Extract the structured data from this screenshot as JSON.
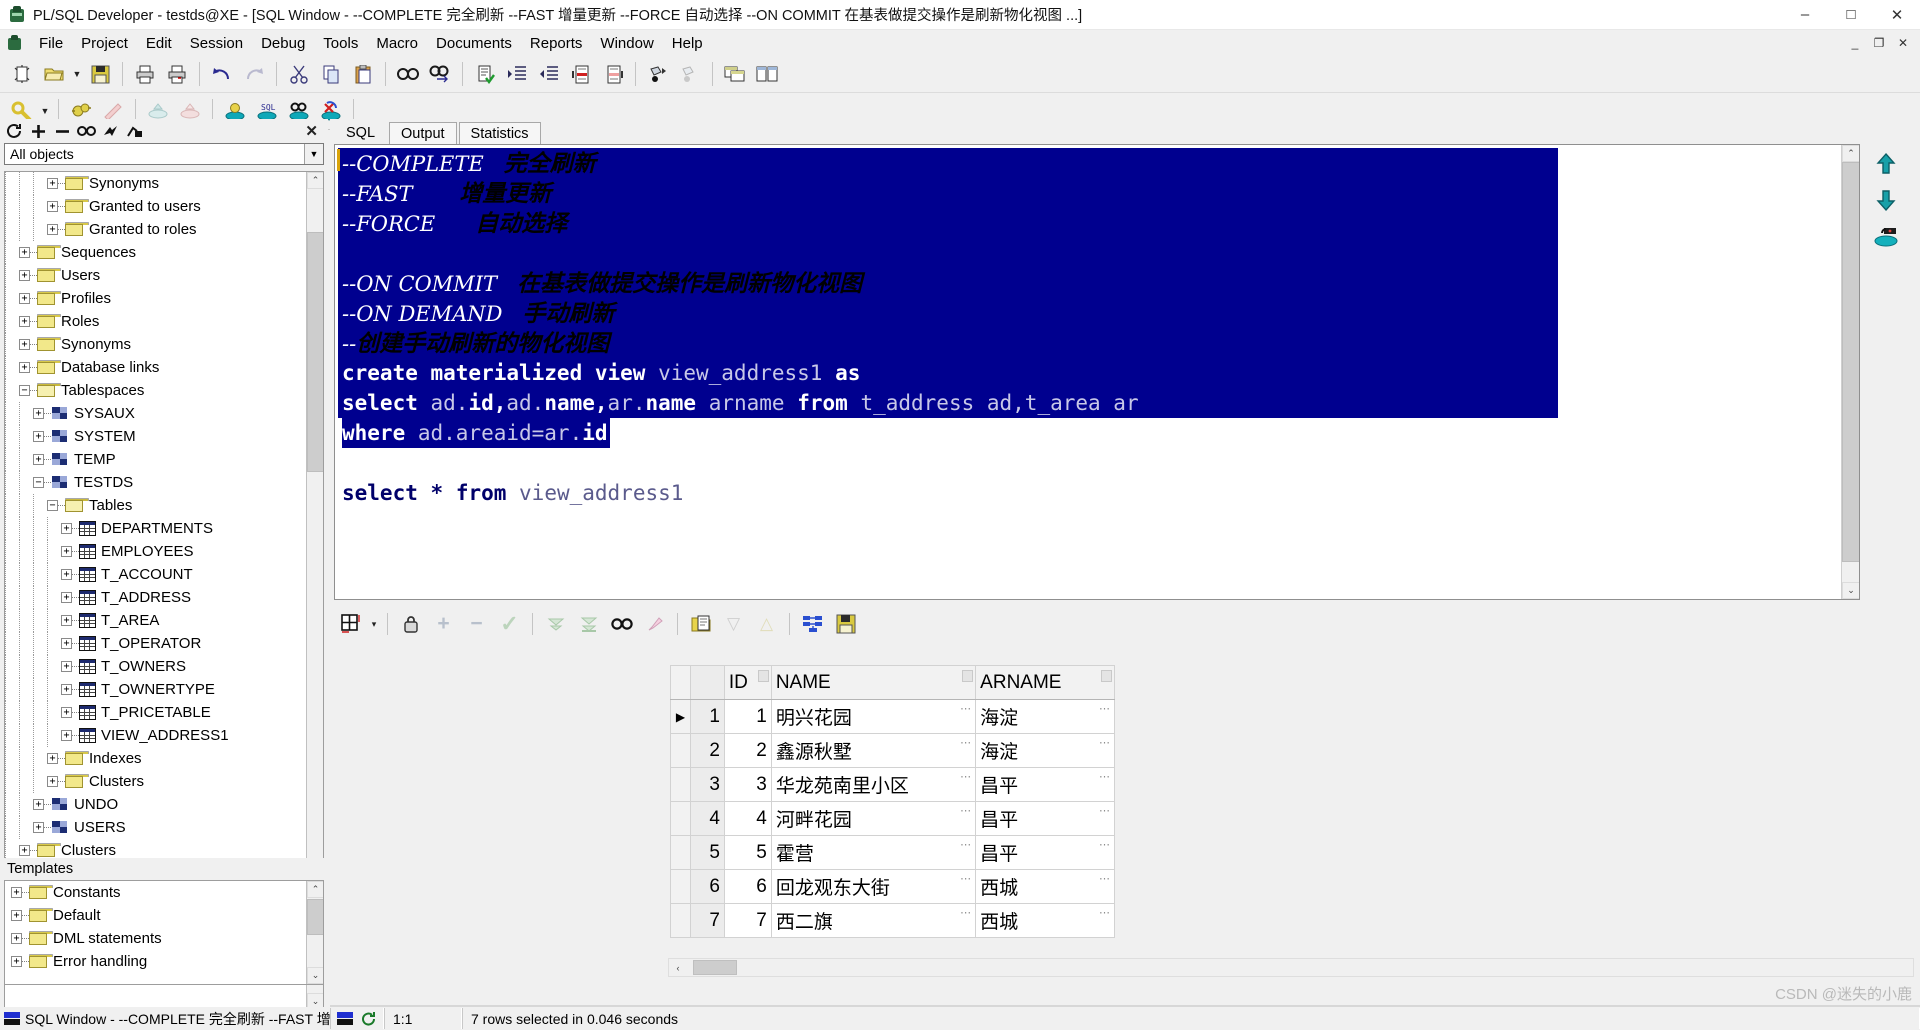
{
  "window": {
    "title": "PL/SQL Developer - testds@XE - [SQL Window - --COMPLETE 完全刷新 --FAST 增量更新 --FORCE 自动选择 --ON COMMIT 在基表做提交操作是刷新物化视图  ...]",
    "app_icon": "plsql-developer-icon",
    "minimize": "–",
    "maximize": "□",
    "close": "✕",
    "mdi_minimize": "_",
    "mdi_restore": "❐",
    "mdi_close": "✕"
  },
  "menu": {
    "items": [
      {
        "label": "File"
      },
      {
        "label": "Project"
      },
      {
        "label": "Edit"
      },
      {
        "label": "Session"
      },
      {
        "label": "Debug"
      },
      {
        "label": "Tools"
      },
      {
        "label": "Macro"
      },
      {
        "label": "Documents"
      },
      {
        "label": "Reports"
      },
      {
        "label": "Window"
      },
      {
        "label": "Help"
      }
    ]
  },
  "toolbar1": [
    {
      "name": "new-icon"
    },
    {
      "name": "open-icon"
    },
    {
      "name": "open-dropdown-icon"
    },
    {
      "name": "save-icon"
    },
    {
      "sep": true
    },
    {
      "name": "print-icon"
    },
    {
      "name": "print-preview-icon"
    },
    {
      "sep": true
    },
    {
      "name": "undo-icon"
    },
    {
      "name": "redo-icon"
    },
    {
      "sep": true
    },
    {
      "name": "cut-icon"
    },
    {
      "name": "copy-icon"
    },
    {
      "name": "paste-icon"
    },
    {
      "sep": true
    },
    {
      "name": "find-icon"
    },
    {
      "name": "find-next-icon"
    },
    {
      "sep": true
    },
    {
      "name": "check-syntax-icon"
    },
    {
      "name": "indent-icon"
    },
    {
      "name": "outdent-icon"
    },
    {
      "name": "comment-icon"
    },
    {
      "name": "uncomment-icon"
    },
    {
      "sep": true
    },
    {
      "name": "record-macro-icon"
    },
    {
      "name": "play-macro-icon"
    }
  ],
  "toolbar2": [
    {
      "name": "explain-plan-icon"
    },
    {
      "name": "explain-dropdown-icon"
    },
    {
      "sep": true
    },
    {
      "name": "debug-icon"
    },
    {
      "name": "run-script-icon"
    },
    {
      "sep": true
    },
    {
      "name": "import-icon"
    },
    {
      "name": "export-icon"
    },
    {
      "sep": true
    },
    {
      "name": "test-window-icon"
    },
    {
      "name": "sql-window-icon"
    },
    {
      "name": "browser-icon"
    },
    {
      "name": "rollback-icon"
    },
    {
      "sep": true
    },
    {
      "name": "help-icon",
      "glyph": "?"
    }
  ],
  "browser": {
    "toolbar": [
      {
        "name": "refresh-icon",
        "glyph": "↻"
      },
      {
        "name": "expand-icon",
        "glyph": "+"
      },
      {
        "name": "collapse-icon",
        "glyph": "−"
      },
      {
        "name": "find-object-icon",
        "glyph": "🔍"
      },
      {
        "name": "filter-icon",
        "glyph": "⚡"
      },
      {
        "name": "folder-options-icon",
        "glyph": "⚙"
      }
    ],
    "close_glyph": "✕",
    "filter": {
      "value": "All objects",
      "placeholder": "All objects",
      "arrow": "▼"
    },
    "tree": [
      {
        "label": "Synonyms",
        "indent": 3,
        "icon": "folder",
        "expander": "+"
      },
      {
        "label": "Granted to users",
        "indent": 3,
        "icon": "folder",
        "expander": "+"
      },
      {
        "label": "Granted to roles",
        "indent": 3,
        "icon": "folder",
        "expander": "+"
      },
      {
        "label": "Sequences",
        "indent": 1,
        "icon": "folder",
        "expander": "+"
      },
      {
        "label": "Users",
        "indent": 1,
        "icon": "folder",
        "expander": "+"
      },
      {
        "label": "Profiles",
        "indent": 1,
        "icon": "folder",
        "expander": "+"
      },
      {
        "label": "Roles",
        "indent": 1,
        "icon": "folder",
        "expander": "+"
      },
      {
        "label": "Synonyms",
        "indent": 1,
        "icon": "folder",
        "expander": "+"
      },
      {
        "label": "Database links",
        "indent": 1,
        "icon": "folder",
        "expander": "+"
      },
      {
        "label": "Tablespaces",
        "indent": 1,
        "icon": "folder-open",
        "expander": "−"
      },
      {
        "label": "SYSAUX",
        "indent": 2,
        "icon": "tablespace",
        "expander": "+"
      },
      {
        "label": "SYSTEM",
        "indent": 2,
        "icon": "tablespace",
        "expander": "+"
      },
      {
        "label": "TEMP",
        "indent": 2,
        "icon": "tablespace",
        "expander": "+"
      },
      {
        "label": "TESTDS",
        "indent": 2,
        "icon": "tablespace",
        "expander": "−"
      },
      {
        "label": "Tables",
        "indent": 3,
        "icon": "folder-open",
        "expander": "−"
      },
      {
        "label": "DEPARTMENTS",
        "indent": 4,
        "icon": "table",
        "expander": "+"
      },
      {
        "label": "EMPLOYEES",
        "indent": 4,
        "icon": "table",
        "expander": "+"
      },
      {
        "label": "T_ACCOUNT",
        "indent": 4,
        "icon": "table",
        "expander": "+"
      },
      {
        "label": "T_ADDRESS",
        "indent": 4,
        "icon": "table",
        "expander": "+"
      },
      {
        "label": "T_AREA",
        "indent": 4,
        "icon": "table",
        "expander": "+"
      },
      {
        "label": "T_OPERATOR",
        "indent": 4,
        "icon": "table",
        "expander": "+"
      },
      {
        "label": "T_OWNERS",
        "indent": 4,
        "icon": "table",
        "expander": "+"
      },
      {
        "label": "T_OWNERTYPE",
        "indent": 4,
        "icon": "table",
        "expander": "+"
      },
      {
        "label": "T_PRICETABLE",
        "indent": 4,
        "icon": "table",
        "expander": "+"
      },
      {
        "label": "VIEW_ADDRESS1",
        "indent": 4,
        "icon": "table",
        "expander": "+"
      },
      {
        "label": "Indexes",
        "indent": 3,
        "icon": "folder",
        "expander": "+"
      },
      {
        "label": "Clusters",
        "indent": 3,
        "icon": "folder",
        "expander": "+"
      },
      {
        "label": "UNDO",
        "indent": 2,
        "icon": "tablespace",
        "expander": "+"
      },
      {
        "label": "USERS",
        "indent": 2,
        "icon": "tablespace",
        "expander": "+"
      },
      {
        "label": "Clusters",
        "indent": 1,
        "icon": "folder",
        "expander": "+"
      }
    ]
  },
  "templates": {
    "header": "Templates",
    "items": [
      {
        "label": "Constants",
        "expander": "+"
      },
      {
        "label": "Default",
        "expander": "+"
      },
      {
        "label": "DML statements",
        "expander": "+"
      },
      {
        "label": "Error handling",
        "expander": "+"
      }
    ],
    "scroll_up": "⌃",
    "scroll_down": "⌄"
  },
  "editor": {
    "tabs": [
      {
        "label": "SQL",
        "active": true
      },
      {
        "label": "Output",
        "active": false
      },
      {
        "label": "Statistics",
        "active": false
      }
    ],
    "lines": [
      {
        "selected": true,
        "segments": [
          {
            "t": "--COMPLETE",
            "c": "cm"
          },
          {
            "t": "   ",
            "c": "cm"
          },
          {
            "t": "完全刷新",
            "c": "cm-cjk"
          }
        ]
      },
      {
        "selected": true,
        "segments": [
          {
            "t": "--FAST",
            "c": "cm"
          },
          {
            "t": "       ",
            "c": "cm"
          },
          {
            "t": "增量更新",
            "c": "cm-cjk"
          }
        ]
      },
      {
        "selected": true,
        "segments": [
          {
            "t": "--FORCE",
            "c": "cm"
          },
          {
            "t": "      ",
            "c": "cm"
          },
          {
            "t": "自动选择",
            "c": "cm-cjk"
          }
        ]
      },
      {
        "selected": true,
        "segments": []
      },
      {
        "selected": true,
        "segments": [
          {
            "t": "--ON COMMIT",
            "c": "cm"
          },
          {
            "t": "   ",
            "c": "cm"
          },
          {
            "t": "在基表做提交操作是刷新物化视图",
            "c": "cm-cjk"
          }
        ]
      },
      {
        "selected": true,
        "segments": [
          {
            "t": "--ON DEMAND",
            "c": "cm"
          },
          {
            "t": "   ",
            "c": "cm"
          },
          {
            "t": "手动刷新",
            "c": "cm-cjk"
          }
        ]
      },
      {
        "selected": true,
        "segments": [
          {
            "t": "--",
            "c": "cm"
          },
          {
            "t": "创建手动刷新的物化视图",
            "c": "cm-cjk"
          }
        ]
      },
      {
        "selected": true,
        "segments": [
          {
            "t": "create materialized view ",
            "c": "kw-on-sel"
          },
          {
            "t": "view_address1 ",
            "c": "id-on-sel"
          },
          {
            "t": "as",
            "c": "kw-on-sel"
          }
        ]
      },
      {
        "selected": true,
        "segments": [
          {
            "t": "select ",
            "c": "kw-on-sel"
          },
          {
            "t": "ad.",
            "c": "id-on-sel"
          },
          {
            "t": "id,",
            "c": "kw-on-sel"
          },
          {
            "t": "ad.",
            "c": "id-on-sel"
          },
          {
            "t": "name,",
            "c": "kw-on-sel"
          },
          {
            "t": "ar.",
            "c": "id-on-sel"
          },
          {
            "t": "name ",
            "c": "kw-on-sel"
          },
          {
            "t": "arname ",
            "c": "id-on-sel"
          },
          {
            "t": "from ",
            "c": "kw-on-sel"
          },
          {
            "t": "t_address ad,t_area ar",
            "c": "id-on-sel"
          }
        ]
      },
      {
        "selected": "partial",
        "sel_chars": 21,
        "segments": [
          {
            "t": "where ",
            "c": "kw-on-sel"
          },
          {
            "t": "ad.areaid=ar.",
            "c": "id-on-sel"
          },
          {
            "t": "id",
            "c": "kw-on-sel"
          }
        ]
      },
      {
        "selected": false,
        "segments": []
      },
      {
        "selected": false,
        "segments": [
          {
            "t": "select ",
            "c": "kw"
          },
          {
            "t": "* ",
            "c": "kw"
          },
          {
            "t": "from ",
            "c": "kw"
          },
          {
            "t": "view_address1",
            "c": "idf"
          }
        ]
      }
    ],
    "scroll_up": "⌃",
    "scroll_down": "⌄",
    "side_buttons": [
      {
        "name": "execute-up-icon"
      },
      {
        "name": "execute-down-icon"
      },
      {
        "name": "commit-icon"
      }
    ]
  },
  "grid_toolbar": [
    {
      "name": "grid-layout-icon"
    },
    {
      "name": "grid-layout-dropdown-icon",
      "glyph": "▾"
    },
    {
      "sep": true
    },
    {
      "name": "lock-icon"
    },
    {
      "name": "add-row-icon",
      "glyph": "+"
    },
    {
      "name": "delete-row-icon",
      "glyph": "−"
    },
    {
      "name": "post-changes-icon",
      "glyph": "✓"
    },
    {
      "sep": true
    },
    {
      "name": "fetch-next-page-icon",
      "glyph": "▼"
    },
    {
      "name": "fetch-last-page-icon",
      "glyph": "▼"
    },
    {
      "name": "find-in-grid-icon"
    },
    {
      "name": "clear-filter-icon"
    },
    {
      "sep": true
    },
    {
      "name": "copy-to-clipboard-icon"
    },
    {
      "name": "sort-descending-icon",
      "glyph": "▽"
    },
    {
      "name": "sort-ascending-icon",
      "glyph": "△"
    },
    {
      "sep": true
    },
    {
      "name": "view-as-xml-icon"
    },
    {
      "name": "export-results-icon"
    }
  ],
  "results": {
    "columns": [
      "",
      "",
      "ID",
      "NAME",
      "ARNAME"
    ],
    "rows": [
      {
        "marker": "▶",
        "num": "1",
        "id": "1",
        "name": "明兴花园",
        "arname": "海淀"
      },
      {
        "marker": "",
        "num": "2",
        "id": "2",
        "name": "鑫源秋墅",
        "arname": "海淀"
      },
      {
        "marker": "",
        "num": "3",
        "id": "3",
        "name": "华龙苑南里小区",
        "arname": "昌平"
      },
      {
        "marker": "",
        "num": "4",
        "id": "4",
        "name": "河畔花园",
        "arname": "昌平"
      },
      {
        "marker": "",
        "num": "5",
        "id": "5",
        "name": "霍营",
        "arname": "昌平"
      },
      {
        "marker": "",
        "num": "6",
        "id": "6",
        "name": "回龙观东大街",
        "arname": "西城"
      },
      {
        "marker": "",
        "num": "7",
        "id": "7",
        "name": "西二旗",
        "arname": "西城"
      }
    ],
    "cell_more": "⋯",
    "hscroll_left": "‹",
    "hscroll_right": "›"
  },
  "statusbar": {
    "window_label": "SQL Window - --COMPLETE 完全刷新 --FAST 增量",
    "window_icon": "sql-window-icon",
    "session_icon": "session-refresh-icon",
    "cursor_position": "1:1",
    "message": "7 rows selected in 0.046 seconds"
  },
  "watermark": "CSDN @迷失的小鹿"
}
